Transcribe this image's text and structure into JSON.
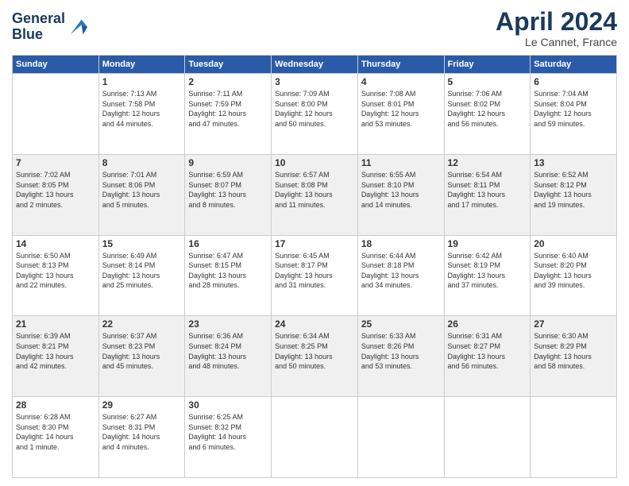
{
  "header": {
    "logo_line1": "General",
    "logo_line2": "Blue",
    "title": "April 2024",
    "location": "Le Cannet, France"
  },
  "weekdays": [
    "Sunday",
    "Monday",
    "Tuesday",
    "Wednesday",
    "Thursday",
    "Friday",
    "Saturday"
  ],
  "weeks": [
    [
      {
        "num": "",
        "info": ""
      },
      {
        "num": "1",
        "info": "Sunrise: 7:13 AM\nSunset: 7:58 PM\nDaylight: 12 hours\nand 44 minutes."
      },
      {
        "num": "2",
        "info": "Sunrise: 7:11 AM\nSunset: 7:59 PM\nDaylight: 12 hours\nand 47 minutes."
      },
      {
        "num": "3",
        "info": "Sunrise: 7:09 AM\nSunset: 8:00 PM\nDaylight: 12 hours\nand 50 minutes."
      },
      {
        "num": "4",
        "info": "Sunrise: 7:08 AM\nSunset: 8:01 PM\nDaylight: 12 hours\nand 53 minutes."
      },
      {
        "num": "5",
        "info": "Sunrise: 7:06 AM\nSunset: 8:02 PM\nDaylight: 12 hours\nand 56 minutes."
      },
      {
        "num": "6",
        "info": "Sunrise: 7:04 AM\nSunset: 8:04 PM\nDaylight: 12 hours\nand 59 minutes."
      }
    ],
    [
      {
        "num": "7",
        "info": "Sunrise: 7:02 AM\nSunset: 8:05 PM\nDaylight: 13 hours\nand 2 minutes."
      },
      {
        "num": "8",
        "info": "Sunrise: 7:01 AM\nSunset: 8:06 PM\nDaylight: 13 hours\nand 5 minutes."
      },
      {
        "num": "9",
        "info": "Sunrise: 6:59 AM\nSunset: 8:07 PM\nDaylight: 13 hours\nand 8 minutes."
      },
      {
        "num": "10",
        "info": "Sunrise: 6:57 AM\nSunset: 8:08 PM\nDaylight: 13 hours\nand 11 minutes."
      },
      {
        "num": "11",
        "info": "Sunrise: 6:55 AM\nSunset: 8:10 PM\nDaylight: 13 hours\nand 14 minutes."
      },
      {
        "num": "12",
        "info": "Sunrise: 6:54 AM\nSunset: 8:11 PM\nDaylight: 13 hours\nand 17 minutes."
      },
      {
        "num": "13",
        "info": "Sunrise: 6:52 AM\nSunset: 8:12 PM\nDaylight: 13 hours\nand 19 minutes."
      }
    ],
    [
      {
        "num": "14",
        "info": "Sunrise: 6:50 AM\nSunset: 8:13 PM\nDaylight: 13 hours\nand 22 minutes."
      },
      {
        "num": "15",
        "info": "Sunrise: 6:49 AM\nSunset: 8:14 PM\nDaylight: 13 hours\nand 25 minutes."
      },
      {
        "num": "16",
        "info": "Sunrise: 6:47 AM\nSunset: 8:15 PM\nDaylight: 13 hours\nand 28 minutes."
      },
      {
        "num": "17",
        "info": "Sunrise: 6:45 AM\nSunset: 8:17 PM\nDaylight: 13 hours\nand 31 minutes."
      },
      {
        "num": "18",
        "info": "Sunrise: 6:44 AM\nSunset: 8:18 PM\nDaylight: 13 hours\nand 34 minutes."
      },
      {
        "num": "19",
        "info": "Sunrise: 6:42 AM\nSunset: 8:19 PM\nDaylight: 13 hours\nand 37 minutes."
      },
      {
        "num": "20",
        "info": "Sunrise: 6:40 AM\nSunset: 8:20 PM\nDaylight: 13 hours\nand 39 minutes."
      }
    ],
    [
      {
        "num": "21",
        "info": "Sunrise: 6:39 AM\nSunset: 8:21 PM\nDaylight: 13 hours\nand 42 minutes."
      },
      {
        "num": "22",
        "info": "Sunrise: 6:37 AM\nSunset: 8:23 PM\nDaylight: 13 hours\nand 45 minutes."
      },
      {
        "num": "23",
        "info": "Sunrise: 6:36 AM\nSunset: 8:24 PM\nDaylight: 13 hours\nand 48 minutes."
      },
      {
        "num": "24",
        "info": "Sunrise: 6:34 AM\nSunset: 8:25 PM\nDaylight: 13 hours\nand 50 minutes."
      },
      {
        "num": "25",
        "info": "Sunrise: 6:33 AM\nSunset: 8:26 PM\nDaylight: 13 hours\nand 53 minutes."
      },
      {
        "num": "26",
        "info": "Sunrise: 6:31 AM\nSunset: 8:27 PM\nDaylight: 13 hours\nand 56 minutes."
      },
      {
        "num": "27",
        "info": "Sunrise: 6:30 AM\nSunset: 8:29 PM\nDaylight: 13 hours\nand 58 minutes."
      }
    ],
    [
      {
        "num": "28",
        "info": "Sunrise: 6:28 AM\nSunset: 8:30 PM\nDaylight: 14 hours\nand 1 minute."
      },
      {
        "num": "29",
        "info": "Sunrise: 6:27 AM\nSunset: 8:31 PM\nDaylight: 14 hours\nand 4 minutes."
      },
      {
        "num": "30",
        "info": "Sunrise: 6:25 AM\nSunset: 8:32 PM\nDaylight: 14 hours\nand 6 minutes."
      },
      {
        "num": "",
        "info": ""
      },
      {
        "num": "",
        "info": ""
      },
      {
        "num": "",
        "info": ""
      },
      {
        "num": "",
        "info": ""
      }
    ]
  ]
}
